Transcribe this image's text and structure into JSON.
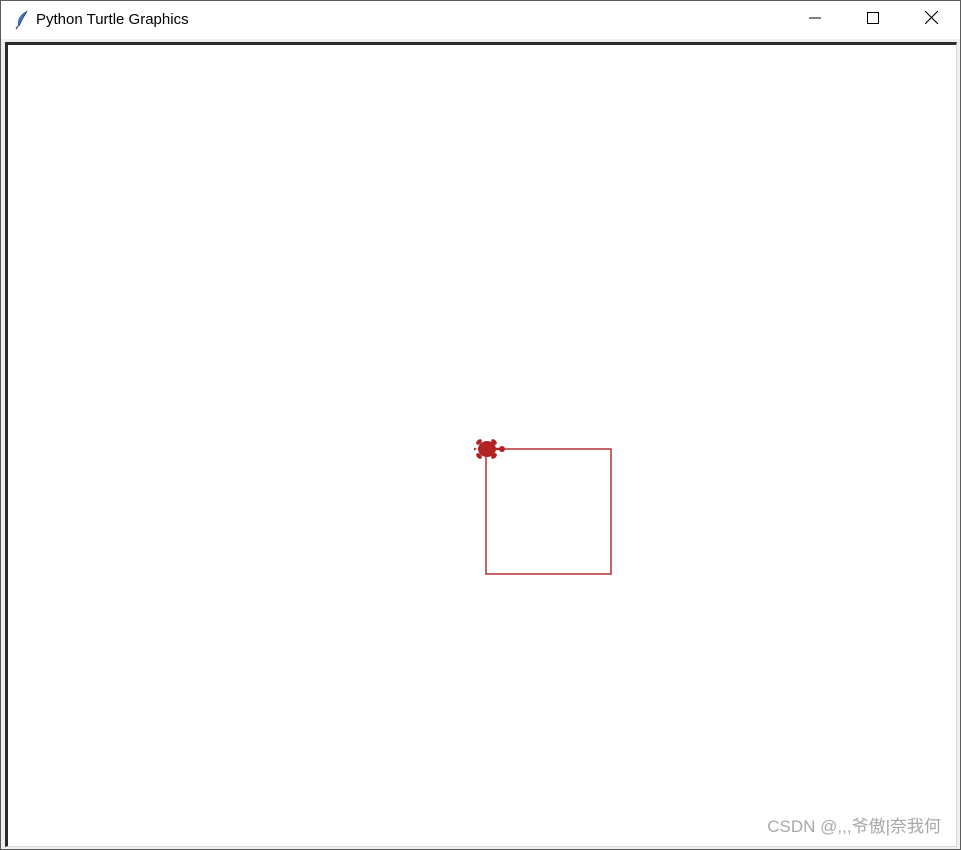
{
  "window": {
    "title": "Python Turtle Graphics",
    "app_icon": "feather-icon",
    "controls": {
      "minimize_icon": "minimize-icon",
      "maximize_icon": "maximize-icon",
      "close_icon": "close-icon"
    }
  },
  "canvas": {
    "background": "#ffffff",
    "pen_color": "#b22222",
    "turtle_shape": "turtle",
    "turtle_color": "#b22222",
    "turtle_heading": "east",
    "drawing": "square"
  },
  "watermark": "CSDN @,,,爷傲|奈我何"
}
